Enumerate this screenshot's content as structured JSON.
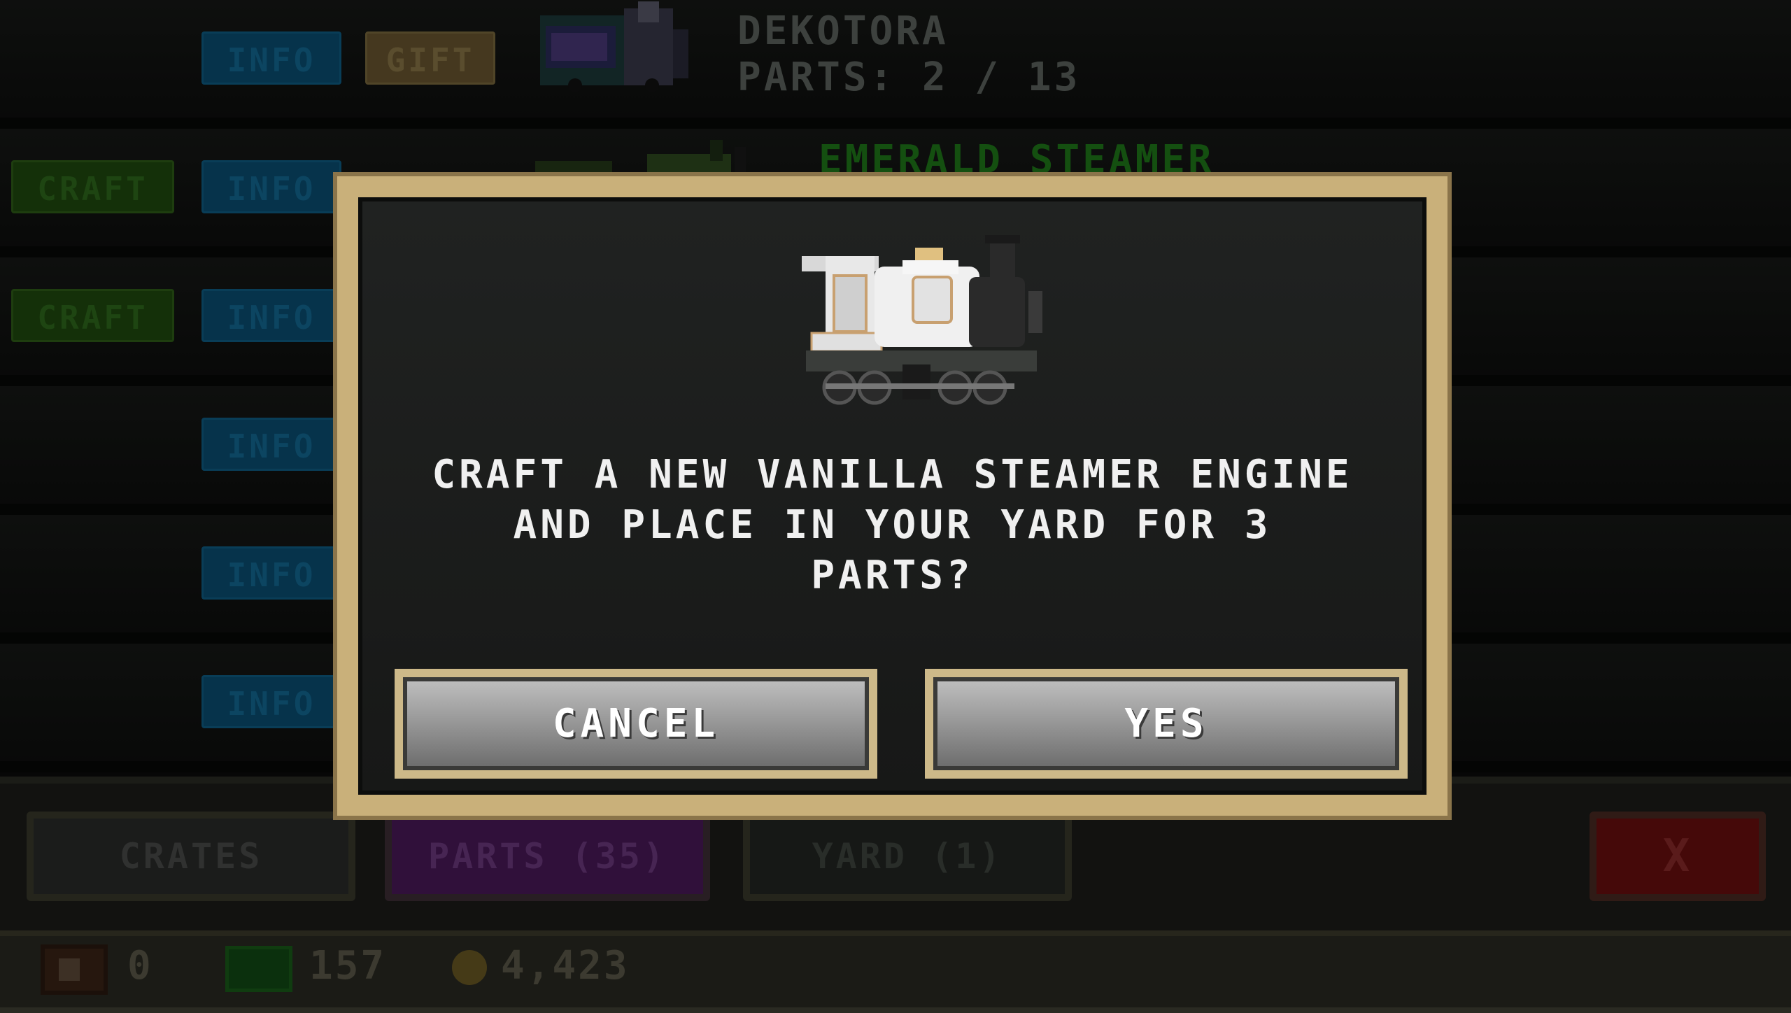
{
  "list": {
    "rows": [
      {
        "info_label": "INFO",
        "gift_label": "GIFT",
        "title": "DEKOTORA",
        "parts": "PARTS: 2 / 13"
      },
      {
        "craft_label": "CRAFT",
        "info_label": "INFO",
        "title": "EMERALD STEAMER"
      },
      {
        "craft_label": "CRAFT",
        "info_label": "INFO"
      },
      {
        "info_label": "INFO"
      },
      {
        "info_label": "INFO"
      },
      {
        "info_label": "INFO"
      }
    ]
  },
  "dialog": {
    "message": "CRAFT A NEW VANILLA STEAMER ENGINE\nAND PLACE IN YOUR YARD FOR 3\nPARTS?",
    "cancel_label": "CANCEL",
    "yes_label": "YES",
    "icon": "steam-locomotive-icon"
  },
  "tabs": {
    "crates": "CRATES",
    "parts": "PARTS (35)",
    "yard": "YARD (1)",
    "close": "X"
  },
  "status": {
    "crates": "0",
    "cash": "157",
    "coins": "4,423"
  },
  "colors": {
    "modal_border": "#c9b07a",
    "parts_tab": "#4a1a5a",
    "close_button": "#6a0f0f"
  }
}
